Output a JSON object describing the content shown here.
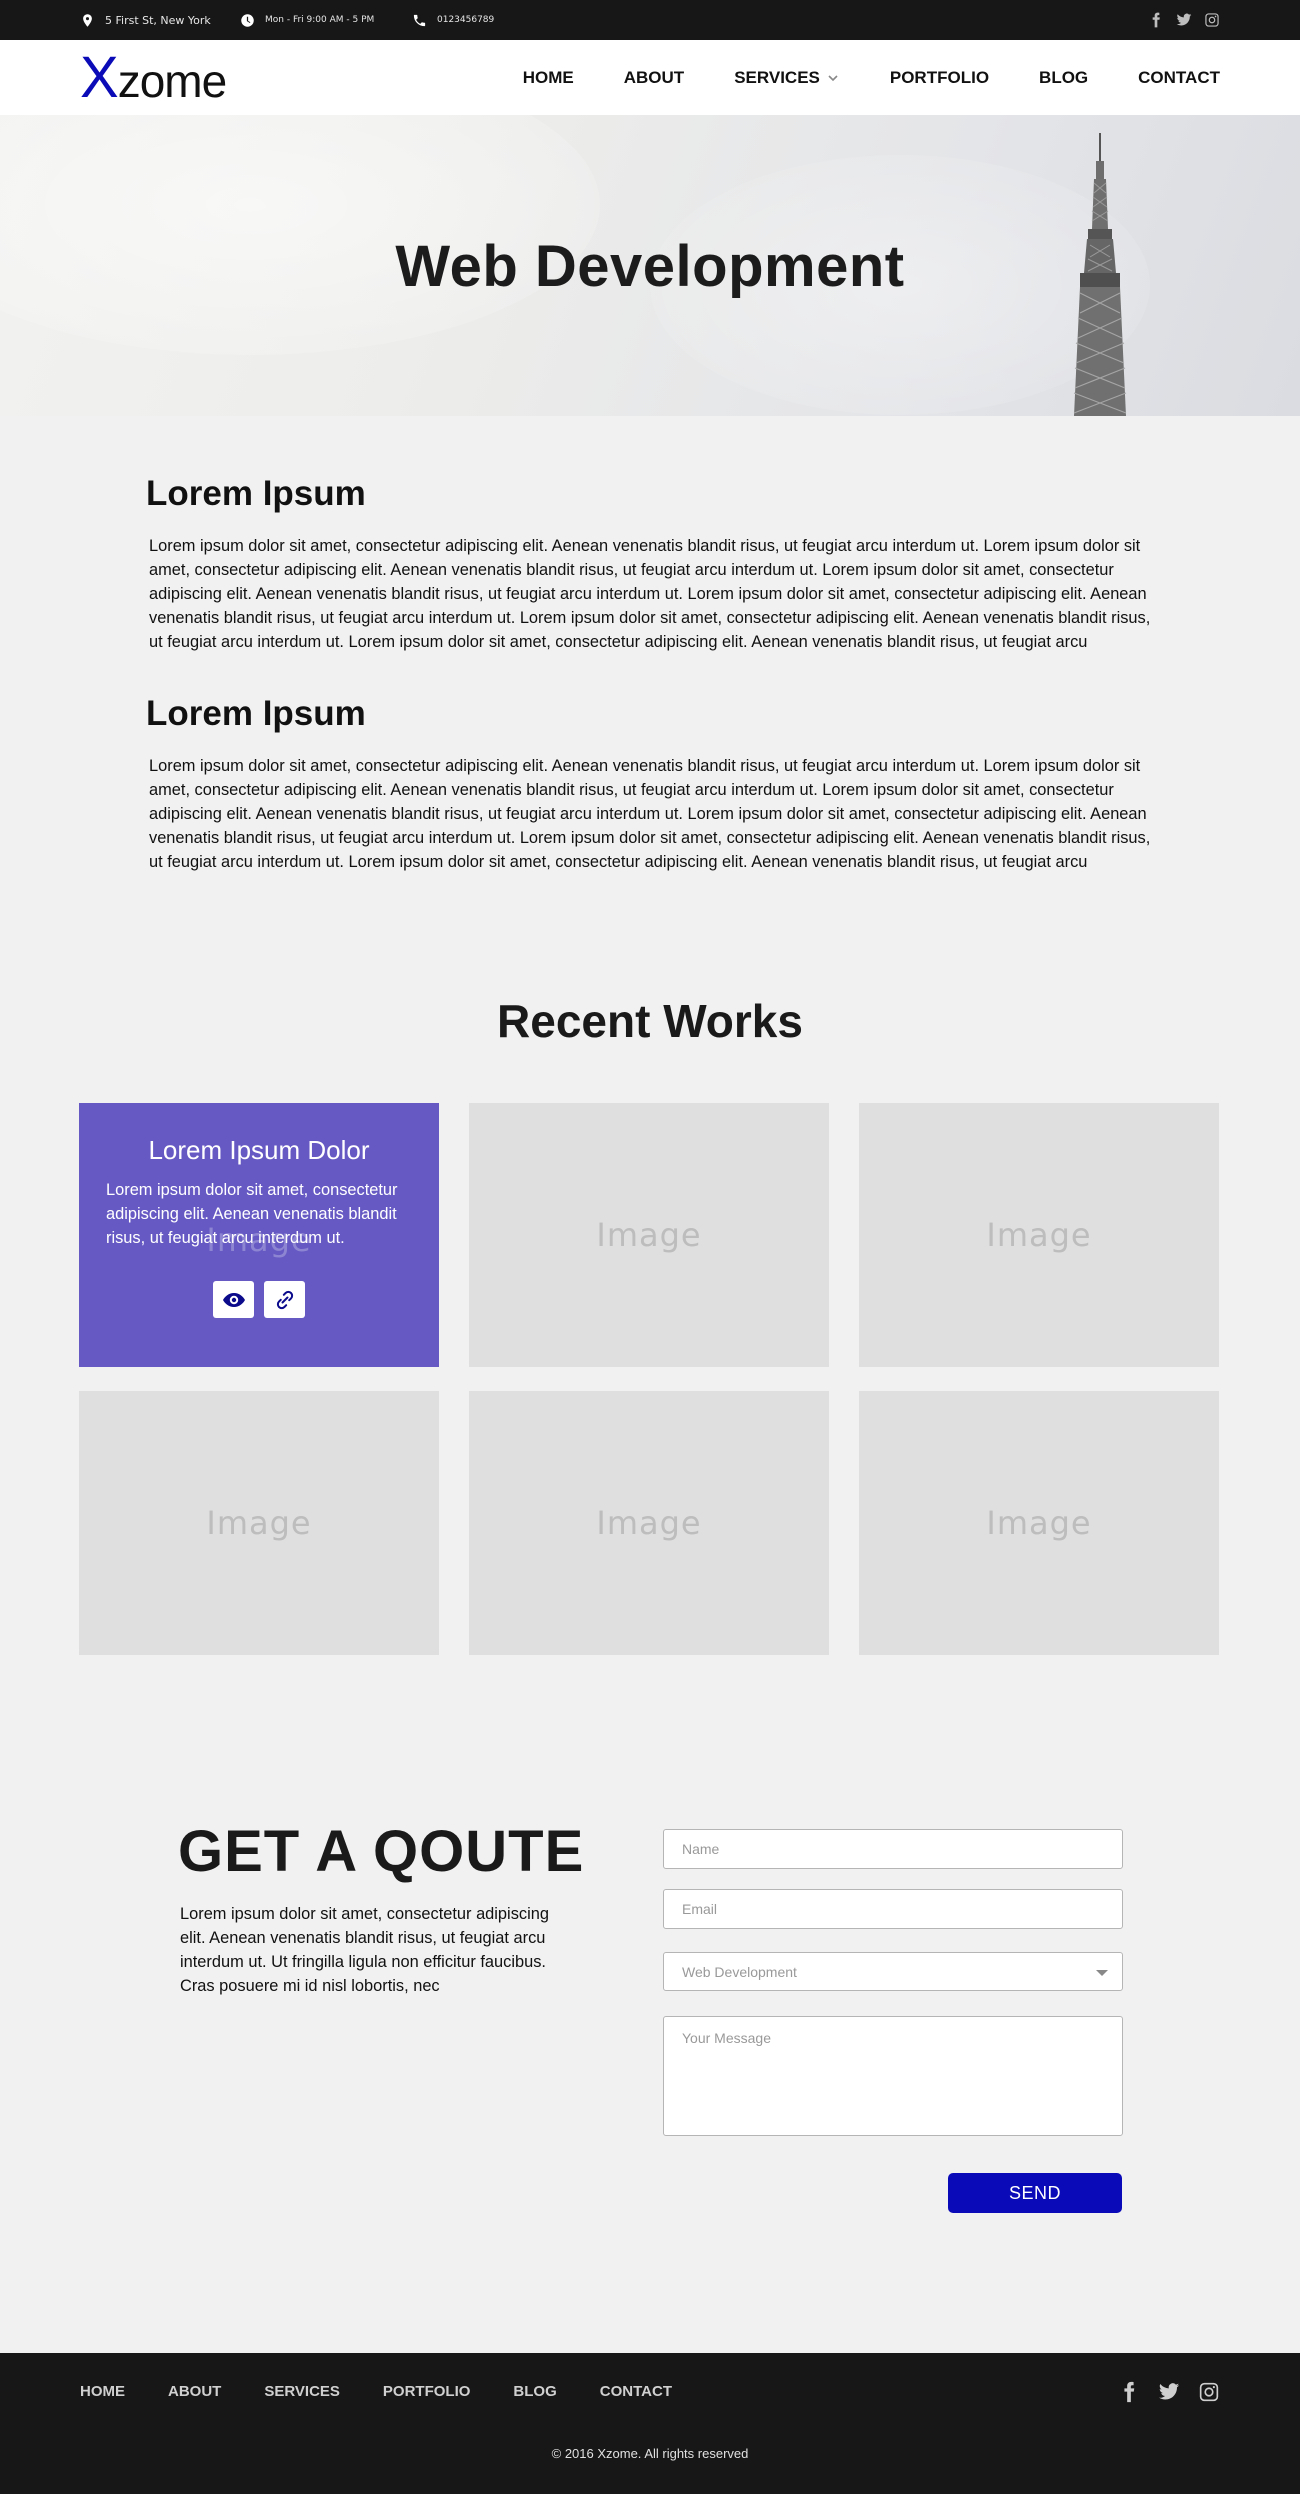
{
  "topbar": {
    "address": "5 First St, New York",
    "hours": "Mon - Fri 9:00 AM - 5 PM",
    "phone": "0123456789",
    "social": [
      "facebook-icon",
      "twitter-icon",
      "instagram-icon"
    ]
  },
  "header": {
    "logo_accent": "X",
    "logo_rest": "zome",
    "nav": [
      "HOME",
      "ABOUT",
      "SERVICES",
      "PORTFOLIO",
      "BLOG",
      "CONTACT"
    ]
  },
  "hero": {
    "title": "Web Development"
  },
  "sections": [
    {
      "title": "Lorem Ipsum",
      "text": "Lorem ipsum dolor sit amet, consectetur adipiscing elit. Aenean venenatis blandit risus, ut feugiat arcu interdum ut. Lorem ipsum dolor sit amet, consectetur adipiscing elit. Aenean venenatis blandit risus, ut feugiat arcu interdum ut. Lorem ipsum dolor sit amet, consectetur adipiscing elit. Aenean venenatis blandit risus, ut feugiat arcu interdum ut. Lorem ipsum dolor sit amet, consectetur adipiscing elit. Aenean venenatis blandit risus, ut feugiat arcu interdum ut. Lorem ipsum dolor sit amet, consectetur adipiscing elit. Aenean venenatis blandit risus, ut feugiat arcu interdum ut. Lorem ipsum dolor sit amet, consectetur adipiscing elit. Aenean venenatis blandit risus, ut feugiat arcu"
    },
    {
      "title": "Lorem Ipsum",
      "text": "Lorem ipsum dolor sit amet, consectetur adipiscing elit. Aenean venenatis blandit risus, ut feugiat arcu interdum ut. Lorem ipsum dolor sit amet, consectetur adipiscing elit. Aenean venenatis blandit risus, ut feugiat arcu interdum ut. Lorem ipsum dolor sit amet, consectetur adipiscing elit. Aenean venenatis blandit risus, ut feugiat arcu interdum ut. Lorem ipsum dolor sit amet, consectetur adipiscing elit. Aenean venenatis blandit risus, ut feugiat arcu interdum ut. Lorem ipsum dolor sit amet, consectetur adipiscing elit. Aenean venenatis blandit risus, ut feugiat arcu interdum ut. Lorem ipsum dolor sit amet, consectetur adipiscing elit. Aenean venenatis blandit risus, ut feugiat arcu"
    }
  ],
  "works": {
    "title": "Recent Works",
    "featured": {
      "title": "Lorem Ipsum Dolor",
      "text": "Lorem ipsum dolor sit amet, consectetur adipiscing elit. Aenean venenatis blandit risus, ut feugiat arcu interdum ut.",
      "buttons": [
        "eye-icon",
        "link-icon"
      ]
    },
    "placeholder": "Image"
  },
  "quote": {
    "title": "GET A QOUTE",
    "text": "Lorem ipsum dolor sit amet, consectetur adipiscing elit. Aenean venenatis blandit risus, ut feugiat arcu interdum ut. Ut fringilla ligula non efficitur faucibus. Cras posuere mi id nisl lobortis, nec",
    "name_placeholder": "Name",
    "email_placeholder": "Email",
    "service_selected": "Web Development",
    "message_placeholder": "Your Message",
    "send_label": "SEND"
  },
  "footer": {
    "nav": [
      "HOME",
      "ABOUT",
      "SERVICES",
      "PORTFOLIO",
      "BLOG",
      "CONTACT"
    ],
    "copyright": "© 2016 Xzome. All rights reserved"
  },
  "colors": {
    "brand": "#0b0bb8",
    "featured_tile": "#6659c4",
    "dark_bar": "#171717",
    "send_button": "#0a0ab8"
  }
}
